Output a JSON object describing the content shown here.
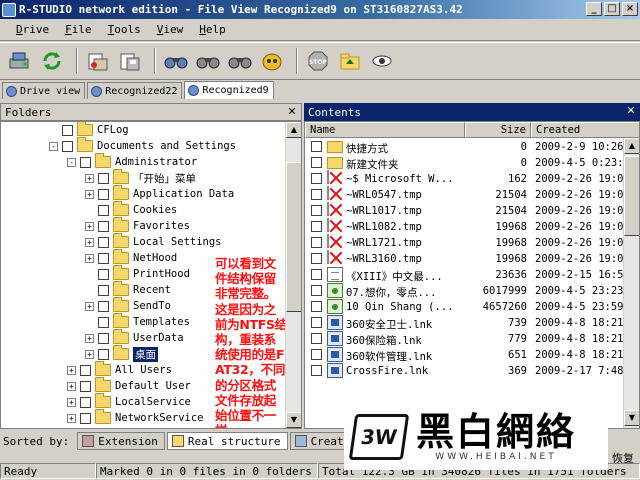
{
  "window": {
    "title": "R-STUDIO network edition - File View Recognized9 on ST3160827AS3.42"
  },
  "menu": [
    {
      "label": "Drive",
      "u": "D",
      "rest": "rive"
    },
    {
      "label": "File",
      "u": "F",
      "rest": "ile"
    },
    {
      "label": "Tools",
      "u": "T",
      "rest": "ools"
    },
    {
      "label": "View",
      "u": "V",
      "rest": "iew"
    },
    {
      "label": "Help",
      "u": "H",
      "rest": "elp"
    }
  ],
  "doc_tabs": [
    {
      "label": "Drive view"
    },
    {
      "label": "Recognized22"
    },
    {
      "label": "Recognized9"
    }
  ],
  "folders_panel": {
    "title": "Folders",
    "rows": [
      {
        "label": "CFLog"
      },
      {
        "label": "Documents and Settings"
      },
      {
        "label": "Administrator"
      },
      {
        "label": "「开始」菜单"
      },
      {
        "label": "Application Data"
      },
      {
        "label": "Cookies"
      },
      {
        "label": "Favorites"
      },
      {
        "label": "Local Settings"
      },
      {
        "label": "NetHood"
      },
      {
        "label": "PrintHood"
      },
      {
        "label": "Recent"
      },
      {
        "label": "SendTo"
      },
      {
        "label": "Templates"
      },
      {
        "label": "UserData"
      },
      {
        "label": "桌面"
      },
      {
        "label": "All Users"
      },
      {
        "label": "Default User"
      },
      {
        "label": "LocalService"
      },
      {
        "label": "NetworkService"
      }
    ]
  },
  "annotation": "可以看到文件结构保留非常完整。这是因为之前为NTFS结构，重装系统使用的是FAT32，不同的分区格式文件存放起始位置不一样。",
  "contents_panel": {
    "title": "Contents",
    "columns": {
      "name": "Name",
      "size": "Size",
      "created": "Created"
    },
    "rows": [
      {
        "icon": "folder-icon",
        "name": "快捷方式",
        "size": "0",
        "created": "2009-2-9 10:26:"
      },
      {
        "icon": "folder-icon",
        "name": "新建文件夹",
        "size": "0",
        "created": "2009-4-5 0:23:5"
      },
      {
        "icon": "deleted-file-icon",
        "name": "~$ Microsoft W...",
        "size": "162",
        "created": "2009-2-26 19:0"
      },
      {
        "icon": "deleted-file-icon",
        "name": "~WRL0547.tmp",
        "size": "21504",
        "created": "2009-2-26 19:0"
      },
      {
        "icon": "deleted-file-icon",
        "name": "~WRL1017.tmp",
        "size": "21504",
        "created": "2009-2-26 19:0"
      },
      {
        "icon": "deleted-file-icon",
        "name": "~WRL1082.tmp",
        "size": "19968",
        "created": "2009-2-26 19:0"
      },
      {
        "icon": "deleted-file-icon",
        "name": "~WRL1721.tmp",
        "size": "19968",
        "created": "2009-2-26 19:0"
      },
      {
        "icon": "deleted-file-icon",
        "name": "~WRL3160.tmp",
        "size": "19968",
        "created": "2009-2-26 19:0"
      },
      {
        "icon": "text-file-icon",
        "name": "《XIII》中文最...",
        "size": "23636",
        "created": "2009-2-15 16:53"
      },
      {
        "icon": "media-file-icon",
        "name": "07.想你，零点...",
        "size": "6017999",
        "created": "2009-4-5 23:23"
      },
      {
        "icon": "media-file-icon",
        "name": "10 Qin Shang (...",
        "size": "4657260",
        "created": "2009-4-5 23:59"
      },
      {
        "icon": "shortcut-icon",
        "name": "360安全卫士.lnk",
        "size": "739",
        "created": "2009-4-8 18:21"
      },
      {
        "icon": "shortcut-icon",
        "name": "360保险箱.lnk",
        "size": "779",
        "created": "2009-4-8 18:21"
      },
      {
        "icon": "shortcut-icon",
        "name": "360软件管理.lnk",
        "size": "651",
        "created": "2009-4-8 18:21"
      },
      {
        "icon": "shortcut-icon",
        "name": "CrossFire.lnk",
        "size": "369",
        "created": "2009-2-17 7:48"
      }
    ]
  },
  "sort_bar": {
    "label": "Sorted by:",
    "tabs": [
      {
        "label": "Extension"
      },
      {
        "label": "Real structure"
      },
      {
        "label": "Creation"
      }
    ]
  },
  "recover_partial": "恢复",
  "status": {
    "ready": "Ready",
    "marked": "Marked 0 in 0 files in 0 folders",
    "total": "Total 122.3 GB in 340826 files in 1751 folders"
  },
  "watermark": {
    "cn": "黑白網絡",
    "url": "WWW.HEIBAI.NET"
  },
  "colors": {
    "title_bar": "#0a246a",
    "annotation": "#ff1010",
    "selection": "#0a246a"
  }
}
